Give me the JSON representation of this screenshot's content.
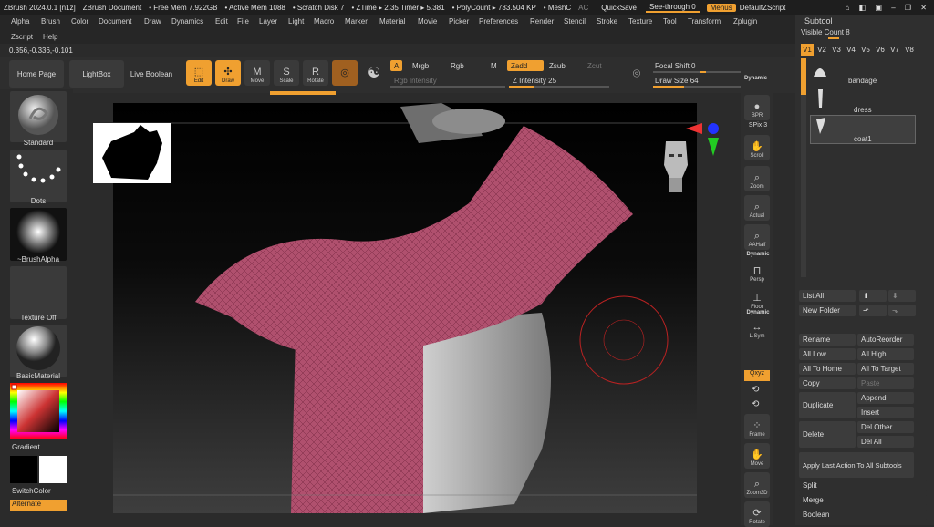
{
  "titlebar": {
    "app": "ZBrush 2024.0.1 [n1z]",
    "document": "ZBrush Document",
    "free_mem": "• Free Mem 7.922GB",
    "active_mem": "• Active Mem 1088",
    "scratch": "• Scratch Disk 7",
    "ztime": "• ZTime ▸ 2.35 Timer ▸ 5.381",
    "polycount": "• PolyCount ▸ 733.504 KP",
    "mesh": "• MeshC",
    "ac": "AC",
    "quicksave": "QuickSave",
    "seethrough": "See-through",
    "seethrough_val": "0",
    "menus": "Menus",
    "defaultzscript": "DefaultZScript"
  },
  "menus_row1": [
    "Alpha",
    "Brush",
    "Color",
    "Document",
    "Draw",
    "Dynamics",
    "Edit",
    "File",
    "Layer",
    "Light",
    "Macro",
    "Marker",
    "Material",
    "Movie",
    "Picker",
    "Preferences",
    "Render",
    "Stencil",
    "Stroke",
    "Texture",
    "Tool",
    "Transform",
    "Zplugin"
  ],
  "menus_row2": [
    "Zscript",
    "Help"
  ],
  "coords": "0.356,-0.336,-0.101",
  "shelf": {
    "home_page": "Home Page",
    "lightbox": "LightBox",
    "live_boolean": "Live Boolean",
    "edit": "Edit",
    "draw": "Draw",
    "move": "Move",
    "scale": "Scale",
    "rotate": "Rotate",
    "a": "A",
    "mrgb": "Mrgb",
    "rgb": "Rgb",
    "m": "M",
    "zadd": "Zadd",
    "zsub": "Zsub",
    "zcut": "Zcut",
    "rgb_intensity": "Rgb Intensity",
    "z_intensity": "Z Intensity",
    "z_intensity_val": "25",
    "focal_shift": "Focal Shift",
    "focal_shift_val": "0",
    "draw_size": "Draw Size",
    "draw_size_val": "64",
    "dynamic": "Dynamic",
    "z_intensity_level": 0.25,
    "draw_size_level": 0.35
  },
  "left": {
    "standard": "Standard",
    "dots": "Dots",
    "brushalpha": "~BrushAlpha",
    "texture_off": "Texture Off",
    "basicmaterial": "BasicMaterial",
    "gradient": "Gradient",
    "switchcolor": "SwitchColor",
    "alternate": "Alternate"
  },
  "rightshelf": {
    "bpr": "BPR",
    "spix": "SPix",
    "spix_val": "3",
    "scroll": "Scroll",
    "zoom": "Zoom",
    "actual": "Actual",
    "aahalf": "AAHalf",
    "dynamic": "Dynamic",
    "persp": "Persp",
    "floor": "Floor",
    "dynamic2": "Dynamic",
    "lsym": "L.Sym",
    "qxyz": "Qxyz",
    "frame": "Frame",
    "move": "Move",
    "zoom3d": "Zoom3D",
    "rotate": "Rotate"
  },
  "subtool": {
    "title": "Subtool",
    "visible_count": "Visible Count",
    "visible_count_val": "8",
    "versions": [
      "V1",
      "V2",
      "V3",
      "V4",
      "V5",
      "V6",
      "V7",
      "V8"
    ],
    "items": [
      "bandage",
      "dress",
      "coat1"
    ],
    "list_all": "List All",
    "new_folder": "New Folder",
    "rename": "Rename",
    "autoreorder": "AutoReorder",
    "all_low": "All Low",
    "all_high": "All High",
    "all_to_home": "All To Home",
    "all_to_target": "All To Target",
    "copy": "Copy",
    "paste": "Paste",
    "duplicate": "Duplicate",
    "append": "Append",
    "insert": "Insert",
    "delete": "Delete",
    "del_other": "Del Other",
    "del_all": "Del All",
    "apply_last": "Apply Last Action To All Subtools",
    "split": "Split",
    "merge": "Merge",
    "boolean": "Boolean"
  },
  "colors": {
    "accent": "#f0a030",
    "cloth": "#b0506e",
    "panel": "#2b2b2b"
  }
}
